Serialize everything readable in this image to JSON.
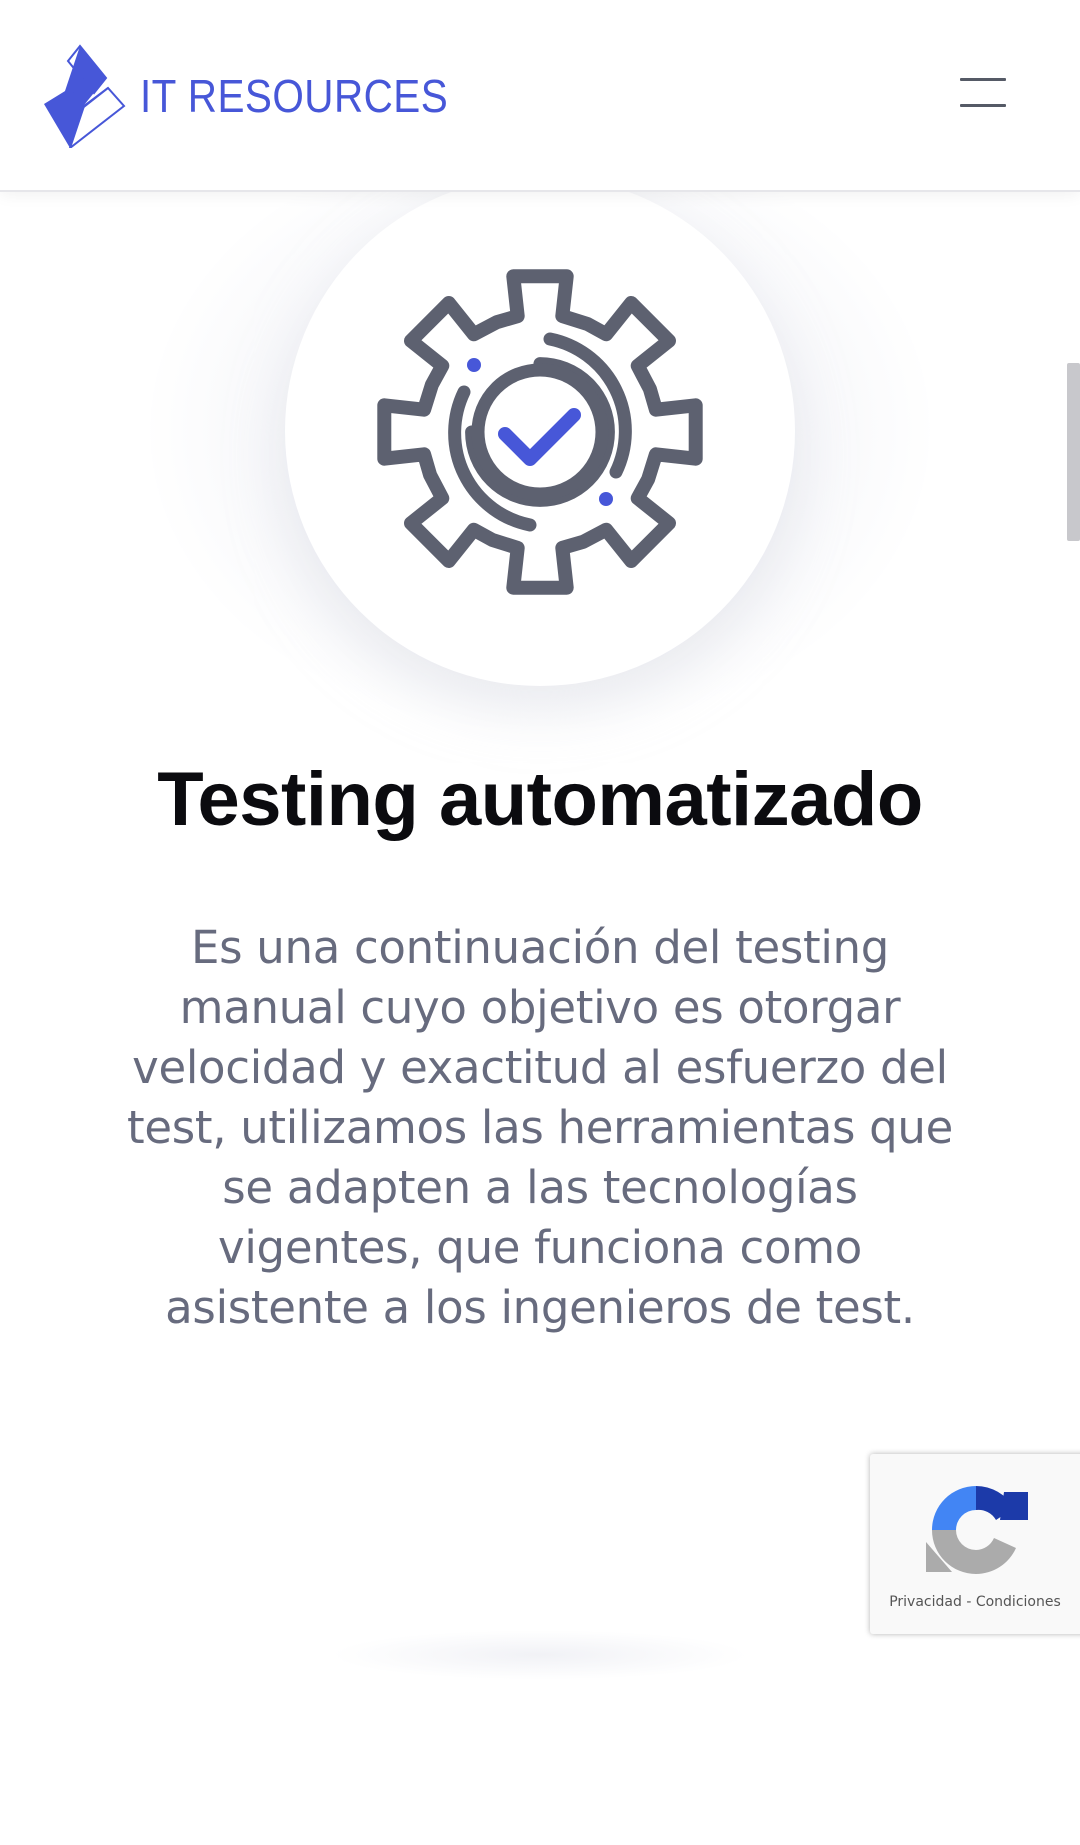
{
  "header": {
    "logo_text": "IT RESOURCES",
    "brand_color": "#4757d8"
  },
  "icon": {
    "name": "gear-check-icon",
    "stroke_color": "#5d6170",
    "accent_color": "#4757d8"
  },
  "content": {
    "title": "Testing automatizado",
    "description": "Es una continuación del testing manual cuyo objetivo es otorgar velocidad y exactitud al esfuerzo del test, utilizamos las herramientas que se adapten a las tecnologías vigentes, que funciona como asistente a los ingenieros de test."
  },
  "recaptcha": {
    "privacy_label": "Privacidad",
    "separator": " - ",
    "terms_label": "Condiciones"
  }
}
